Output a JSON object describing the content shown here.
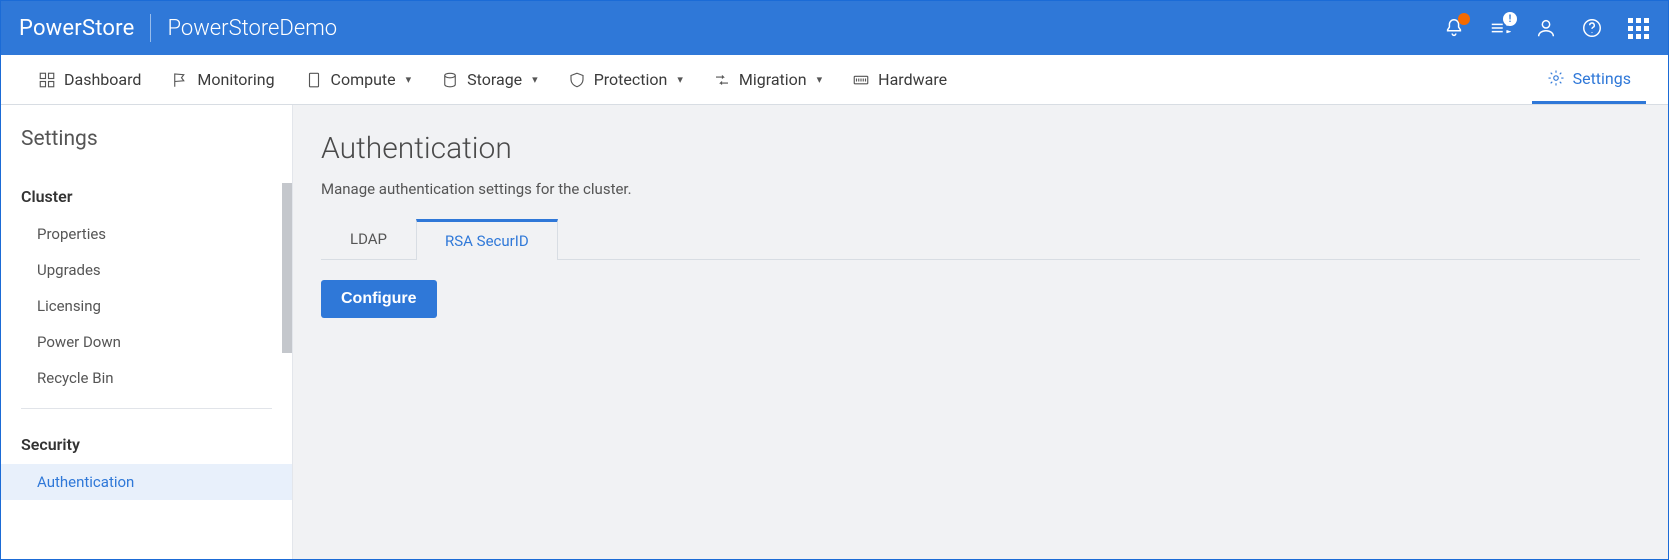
{
  "brand": "PowerStore",
  "system_name": "PowerStoreDemo",
  "topbar_icons": {
    "job_badge": "!"
  },
  "nav": {
    "dashboard": "Dashboard",
    "monitoring": "Monitoring",
    "compute": "Compute",
    "storage": "Storage",
    "protection": "Protection",
    "migration": "Migration",
    "hardware": "Hardware",
    "settings": "Settings"
  },
  "sidebar": {
    "title": "Settings",
    "groups": {
      "cluster": {
        "label": "Cluster",
        "items": {
          "properties": "Properties",
          "upgrades": "Upgrades",
          "licensing": "Licensing",
          "power_down": "Power Down",
          "recycle_bin": "Recycle Bin"
        }
      },
      "security": {
        "label": "Security",
        "items": {
          "authentication": "Authentication"
        }
      }
    }
  },
  "page": {
    "title": "Authentication",
    "subtitle": "Manage authentication settings for the cluster.",
    "tabs": {
      "ldap": "LDAP",
      "rsa": "RSA SecurID"
    },
    "configure_btn": "Configure"
  }
}
